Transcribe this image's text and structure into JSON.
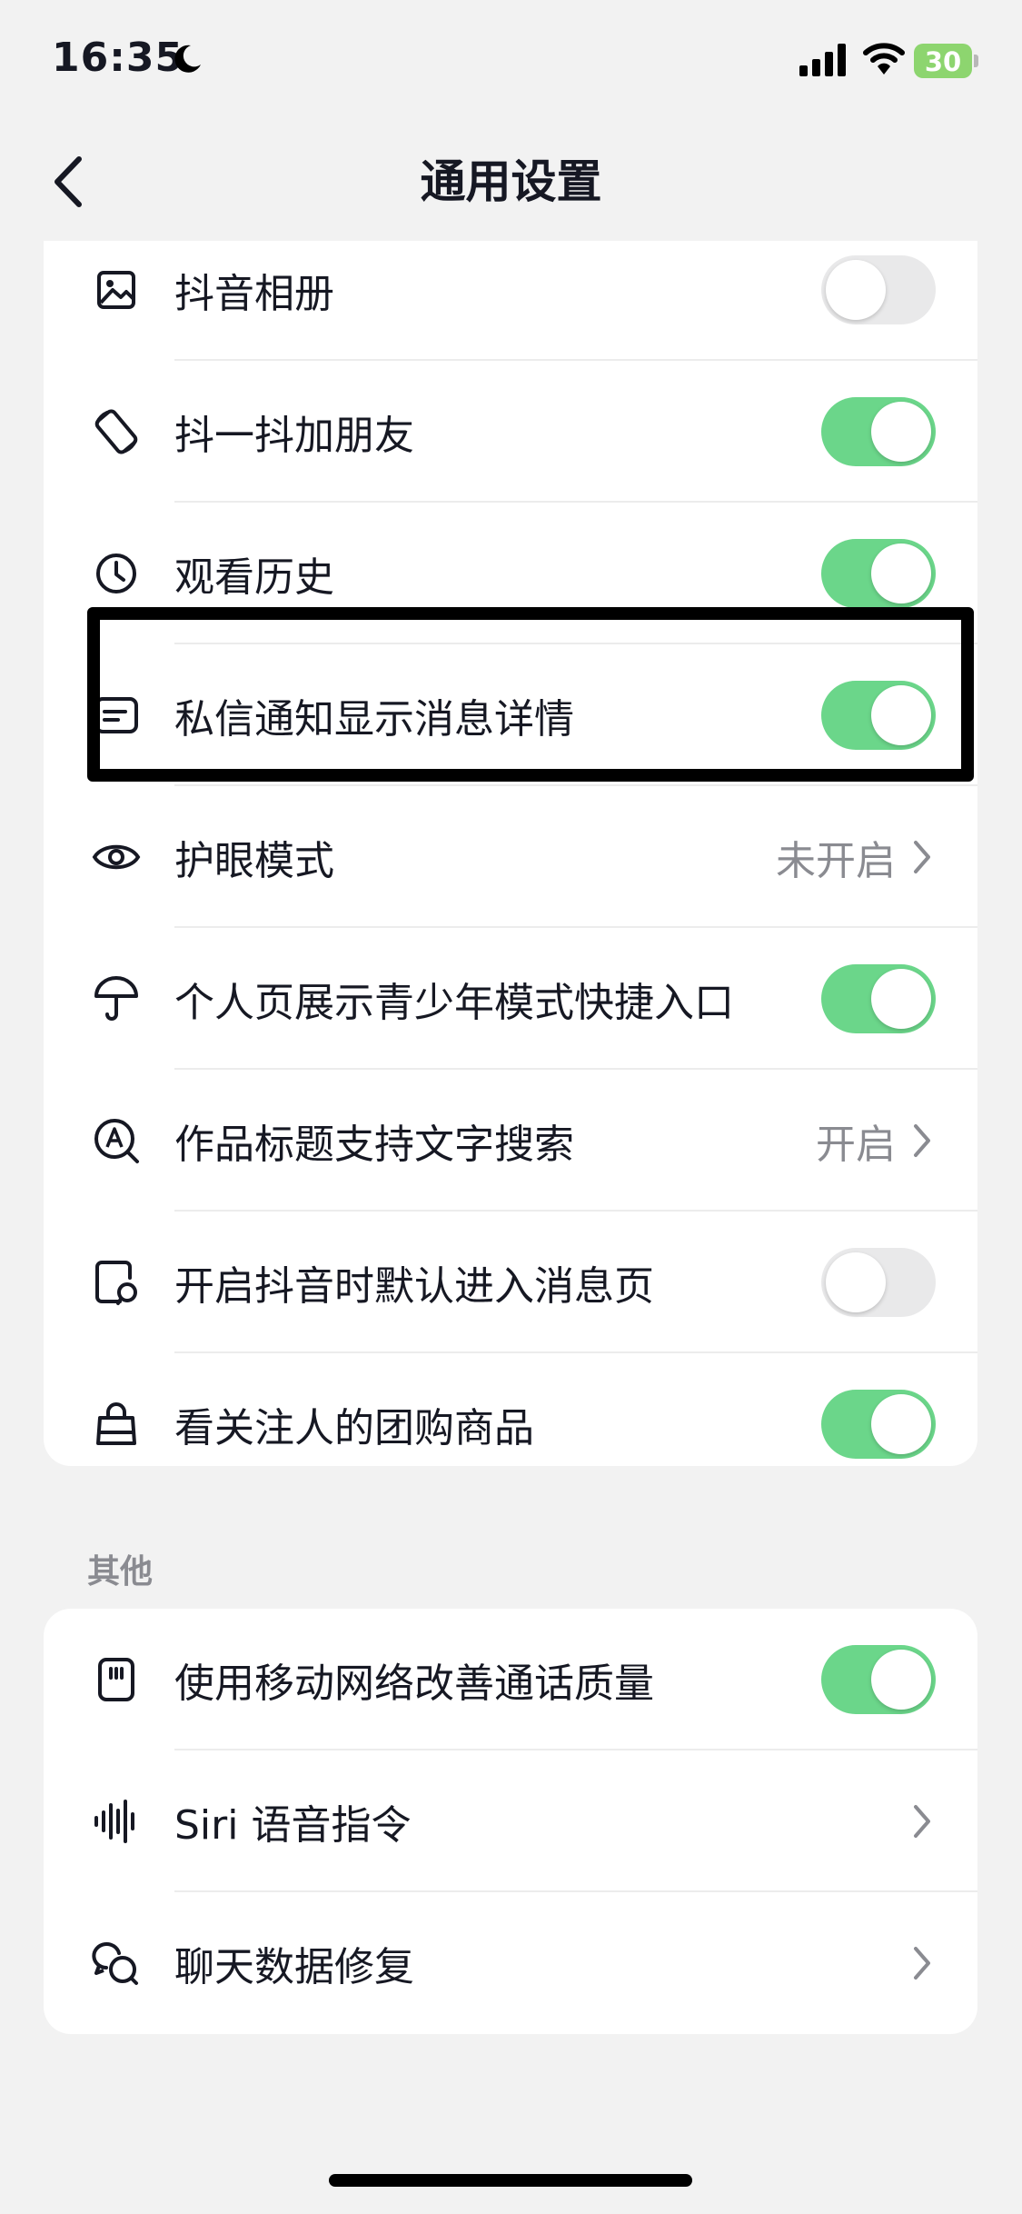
{
  "status_bar": {
    "time": "16:35",
    "battery": "30"
  },
  "header": {
    "title": "通用设置"
  },
  "general_items": [
    {
      "label": "抖音相册",
      "icon": "image-icon",
      "control": "toggle",
      "state": "off"
    },
    {
      "label": "抖一抖加朋友",
      "icon": "rotate-phone-icon",
      "control": "toggle",
      "state": "on"
    },
    {
      "label": "观看历史",
      "icon": "clock-icon",
      "control": "toggle",
      "state": "on"
    },
    {
      "label": "私信通知显示消息详情",
      "icon": "message-card-icon",
      "control": "toggle",
      "state": "on"
    },
    {
      "label": "护眼模式",
      "icon": "eye-icon",
      "control": "link",
      "value": "未开启"
    },
    {
      "label": "个人页展示青少年模式快捷入口",
      "icon": "umbrella-icon",
      "control": "toggle",
      "state": "on"
    },
    {
      "label": "作品标题支持文字搜索",
      "icon": "search-a-icon",
      "control": "link",
      "value": "开启"
    },
    {
      "label": "开启抖音时默认进入消息页",
      "icon": "page-chat-icon",
      "control": "toggle",
      "state": "off"
    },
    {
      "label": "看关注人的团购商品",
      "icon": "shopping-bag-icon",
      "control": "toggle",
      "state": "on"
    }
  ],
  "other_section": {
    "title": "其他",
    "items": [
      {
        "label": "使用移动网络改善通话质量",
        "icon": "sim-card-icon",
        "control": "toggle",
        "state": "on"
      },
      {
        "label": "Siri 语音指令",
        "icon": "sound-wave-icon",
        "control": "link"
      },
      {
        "label": "聊天数据修复",
        "icon": "chat-bubbles-icon",
        "control": "link"
      }
    ]
  },
  "colors": {
    "toggle_on": "#6bd68a",
    "toggle_off": "#e9e9ea",
    "background": "#f2f2f2"
  }
}
